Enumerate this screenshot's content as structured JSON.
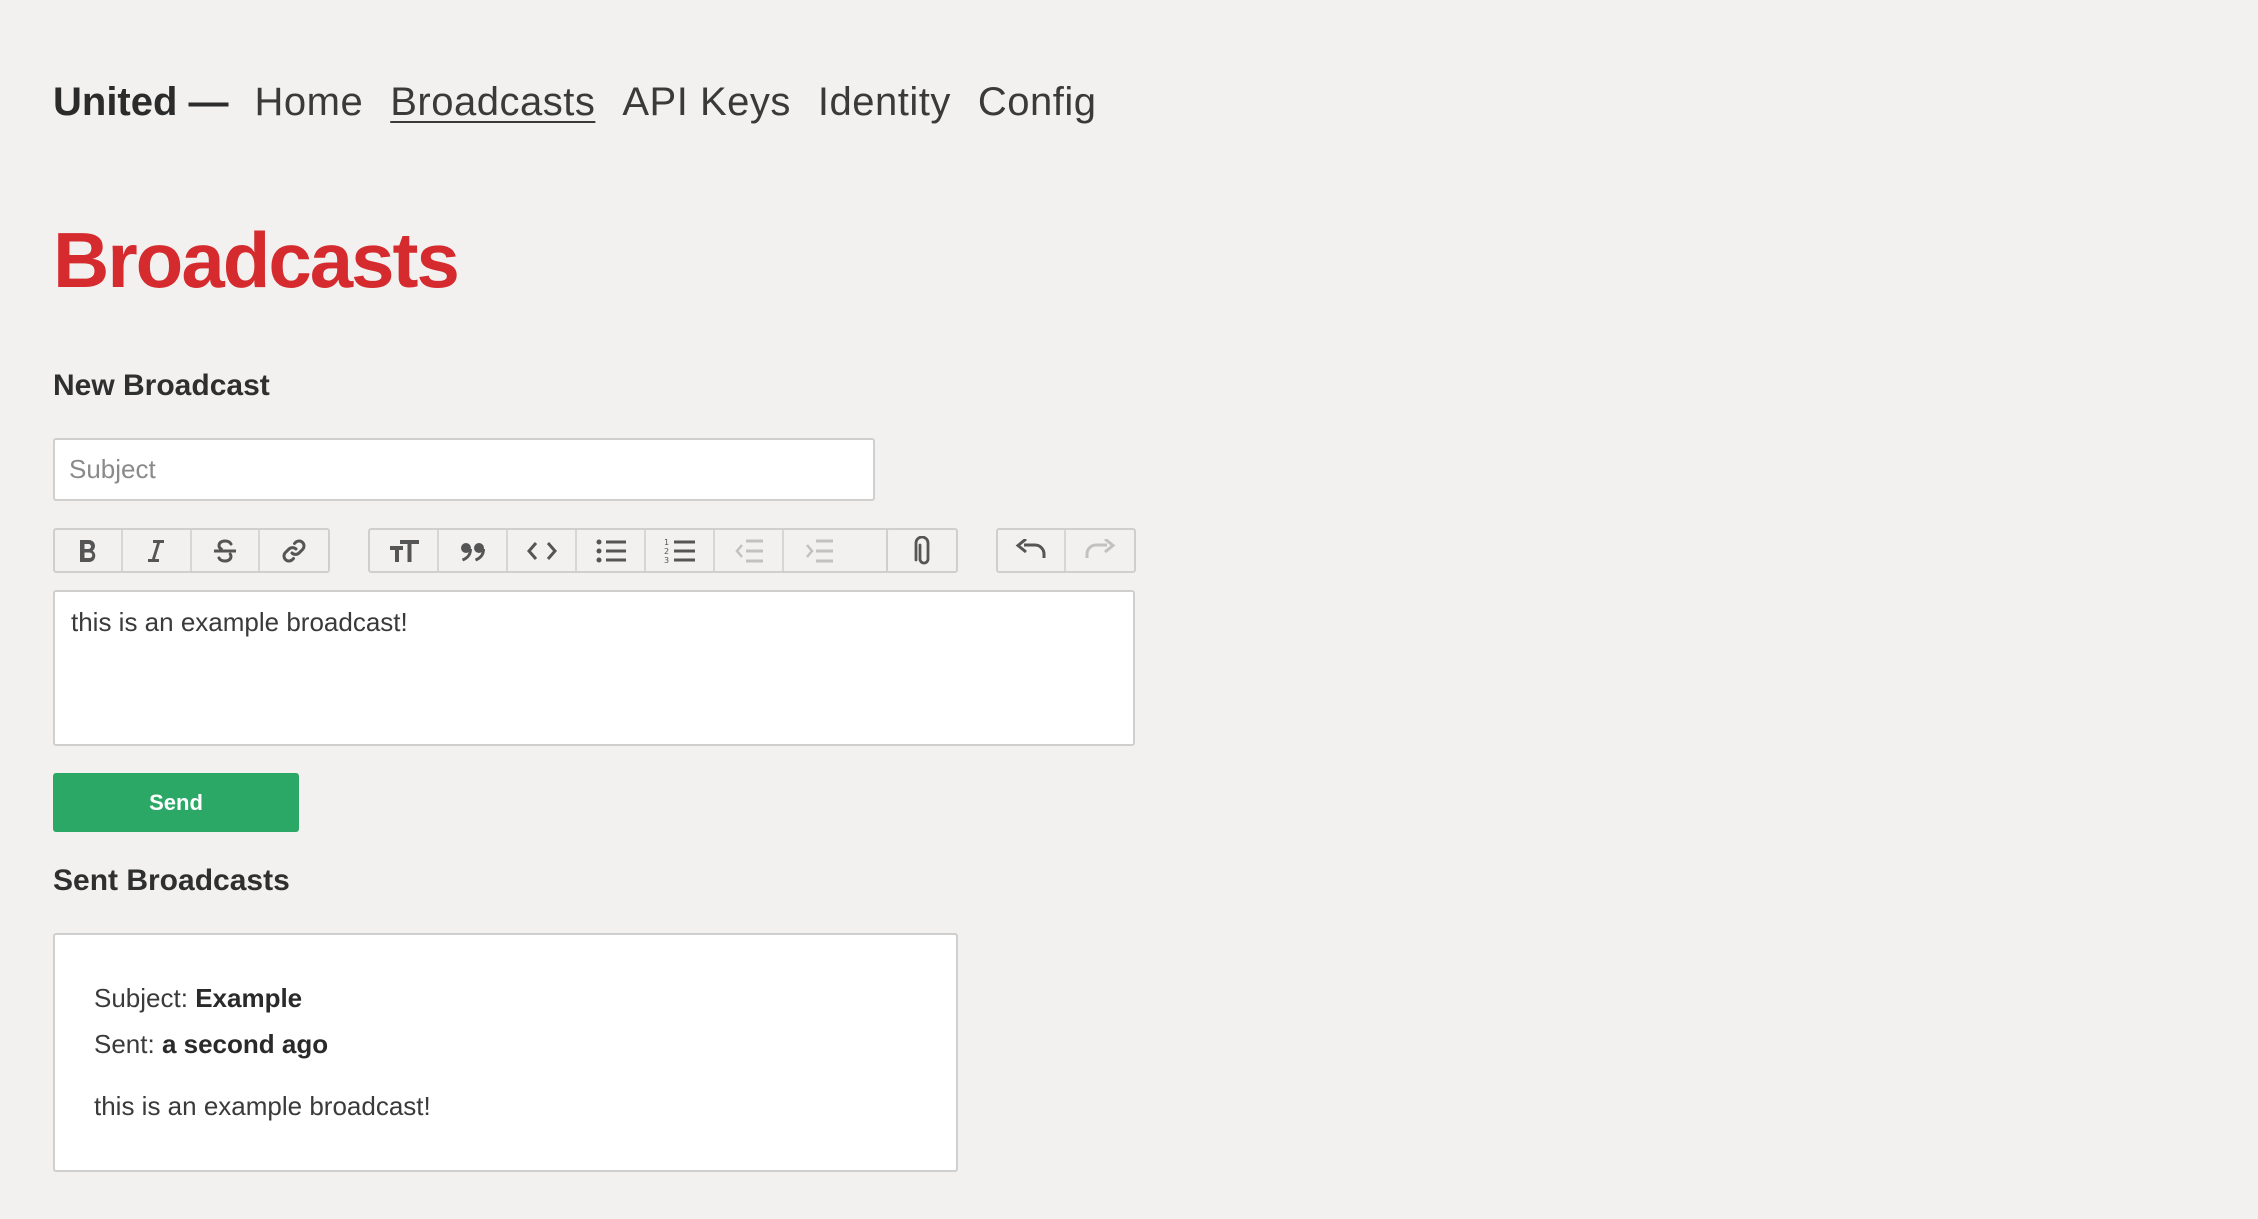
{
  "nav": {
    "brand": "United —",
    "links": [
      {
        "label": "Home",
        "active": false
      },
      {
        "label": "Broadcasts",
        "active": true
      },
      {
        "label": "API Keys",
        "active": false
      },
      {
        "label": "Identity",
        "active": false
      },
      {
        "label": "Config",
        "active": false
      }
    ]
  },
  "page": {
    "title": "Broadcasts",
    "title_color": "#d52b2e"
  },
  "new_broadcast": {
    "heading": "New Broadcast",
    "subject_placeholder": "Subject",
    "subject_value": "",
    "toolbar": {
      "text_group": [
        "bold-icon",
        "italic-icon",
        "strikethrough-icon",
        "link-icon"
      ],
      "block_group": [
        "heading-icon",
        "quote-icon",
        "code-icon",
        "bullet-list-icon",
        "numbered-list-icon",
        "outdent-icon",
        "indent-icon"
      ],
      "file_group": [
        "attach-icon"
      ],
      "history_group": [
        "undo-icon",
        "redo-icon"
      ]
    },
    "editor_content": "this is an example broadcast!",
    "send_label": "Send",
    "send_color": "#2ba866"
  },
  "sent_broadcasts": {
    "heading": "Sent Broadcasts",
    "items": [
      {
        "subject_label": "Subject:",
        "subject": "Example",
        "sent_label": "Sent:",
        "sent": "a second ago",
        "body": "this is an example broadcast!"
      }
    ]
  }
}
